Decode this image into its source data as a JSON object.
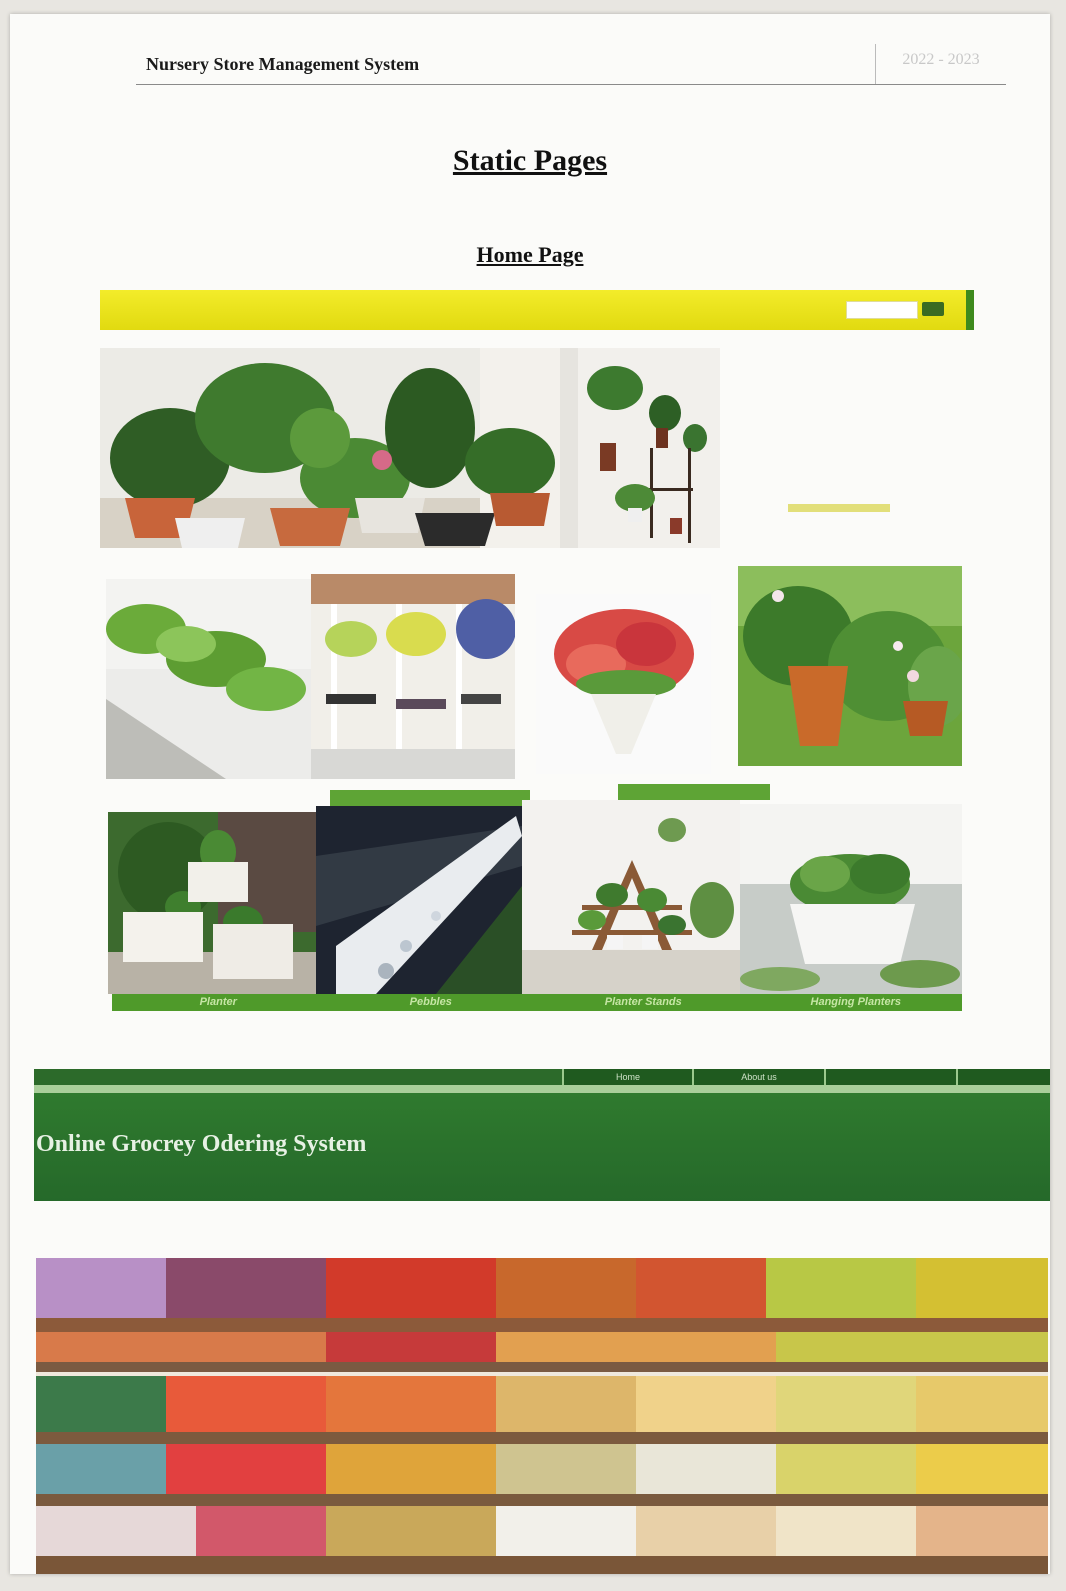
{
  "document": {
    "header_title": "Nursery Store Management System",
    "header_year": "2022 - 2023",
    "section_title": "Static Pages",
    "subsection_title": "Home Page"
  },
  "nursery_site": {
    "colors": {
      "nav_bg": "#f0e826",
      "accent_green": "#4f9a2a"
    },
    "captions": [
      "Planter",
      "Pebbles",
      "Planter Stands",
      "Hanging Planters"
    ]
  },
  "grocery_site": {
    "title": "Online Grocrey Odering System",
    "nav_tabs": [
      "Home",
      "About us"
    ],
    "colors": {
      "banner_bg": "#2c742c"
    }
  }
}
